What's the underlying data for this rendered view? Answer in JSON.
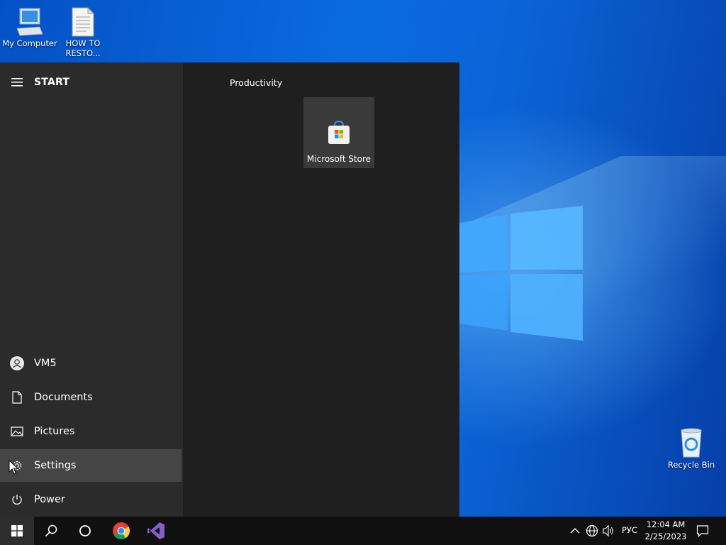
{
  "desktop": {
    "icons": [
      {
        "label": "My Computer"
      },
      {
        "label_line1": "HOW TO",
        "label_line2": "RESTO..."
      },
      {
        "label": "Recycle Bin"
      }
    ]
  },
  "start_menu": {
    "title": "START",
    "group_label": "Productivity",
    "tile_label": "Microsoft Store",
    "left_items": [
      {
        "label": "VM5",
        "icon": "user-icon"
      },
      {
        "label": "Documents",
        "icon": "document-icon"
      },
      {
        "label": "Pictures",
        "icon": "pictures-icon"
      },
      {
        "label": "Settings",
        "icon": "gear-icon"
      },
      {
        "label": "Power",
        "icon": "power-icon"
      }
    ]
  },
  "taskbar": {
    "language": "РУС",
    "time": "12:04 AM",
    "date": "2/25/2023"
  },
  "colors": {
    "start_bg": "#1f1f1f",
    "start_left_bg": "#2b2b2b",
    "hover_bg": "#454545",
    "taskbar_bg": "#101010"
  }
}
